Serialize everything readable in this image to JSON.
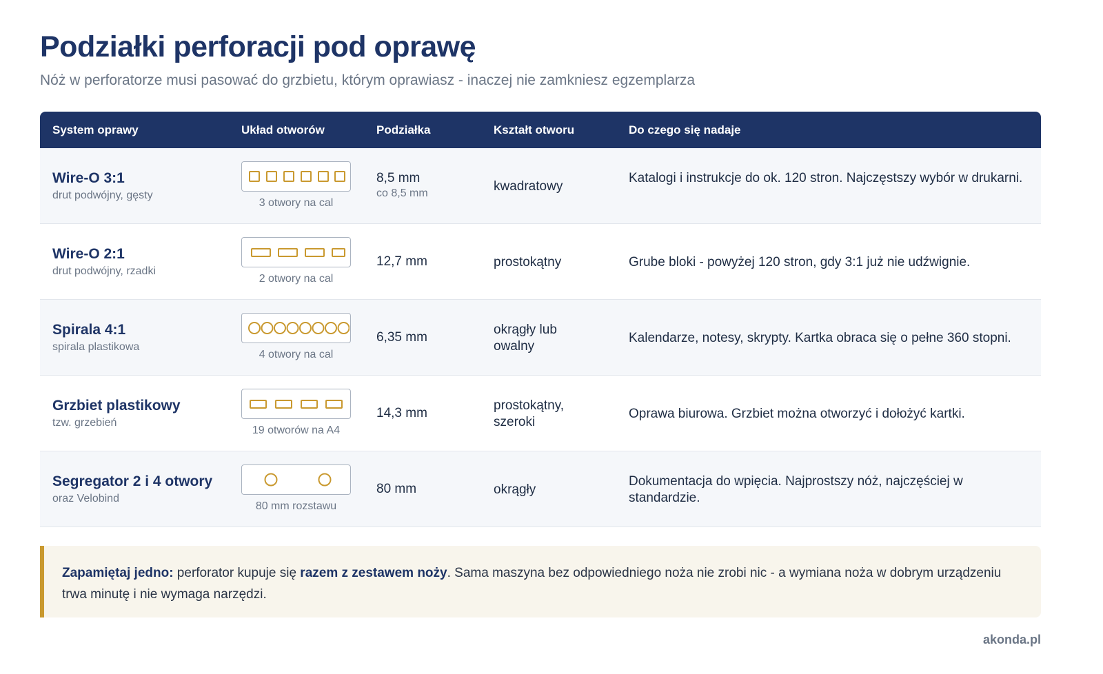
{
  "header": {
    "title": "Podziałki perforacji pod oprawę",
    "subtitle": "Nóż w perforatorze musi pasować do grzbietu, którym oprawiasz - inaczej nie zamkniesz egzemplarza"
  },
  "table": {
    "columns": [
      "System oprawy",
      "Układ otworów",
      "Podziałka",
      "Kształt otworu",
      "Do czego się nadaje"
    ],
    "rows": [
      {
        "name": "Wire-O 3:1",
        "sub": "drut podwójny, gęsty",
        "hole_icon": "square-holes-6",
        "hole_caption": "3 otwory na cal",
        "pitch": "8,5 mm",
        "pitch_sub": "co 8,5 mm",
        "shape": "kwadratowy",
        "usage": "Katalogi i instrukcje do ok. 120 stron. Najczęstszy wybór w drukarni."
      },
      {
        "name": "Wire-O 2:1",
        "sub": "drut podwójny, rzadki",
        "hole_icon": "rect-holes-4",
        "hole_caption": "2 otwory na cal",
        "pitch": "12,7 mm",
        "pitch_sub": "",
        "shape": "prostokątny",
        "usage": "Grube bloki - powyżej 120 stron, gdy 3:1 już nie udźwignie."
      },
      {
        "name": "Spirala 4:1",
        "sub": "spirala plastikowa",
        "hole_icon": "round-holes-8",
        "hole_caption": "4 otwory na cal",
        "pitch": "6,35 mm",
        "pitch_sub": "",
        "shape": "okrągły lub owalny",
        "usage": "Kalendarze, notesy, skrypty. Kartka obraca się o pełne 360 stopni."
      },
      {
        "name": "Grzbiet plastikowy",
        "sub": "tzw. grzebień",
        "hole_icon": "wide-rect-holes-4",
        "hole_caption": "19 otworów na A4",
        "pitch": "14,3 mm",
        "pitch_sub": "",
        "shape": "prostokątny, szeroki",
        "usage": "Oprawa biurowa. Grzbiet można otworzyć i dołożyć kartki."
      },
      {
        "name": "Segregator 2 i 4 otwory",
        "sub": "oraz Velobind",
        "hole_icon": "round-holes-2",
        "hole_caption": "80 mm rozstawu",
        "pitch": "80 mm",
        "pitch_sub": "",
        "shape": "okrągły",
        "usage": "Dokumentacja do wpięcia. Najprostszy nóż, najczęściej w standardzie."
      }
    ]
  },
  "note": {
    "lead": "Zapamiętaj jedno:",
    "text1": " perforator kupuje się ",
    "emph": "razem z zestawem noży",
    "text2": ". Sama maszyna bez odpowiedniego noża nie zrobi nic - a wymiana noża w dobrym urządzeniu trwa minutę i nie wymaga narzędzi."
  },
  "footer": {
    "brand": "akonda.pl"
  },
  "colors": {
    "navy": "#1e3466",
    "gold": "#c9992f",
    "muted": "#6b7686",
    "note_bg": "#f8f5ec"
  }
}
